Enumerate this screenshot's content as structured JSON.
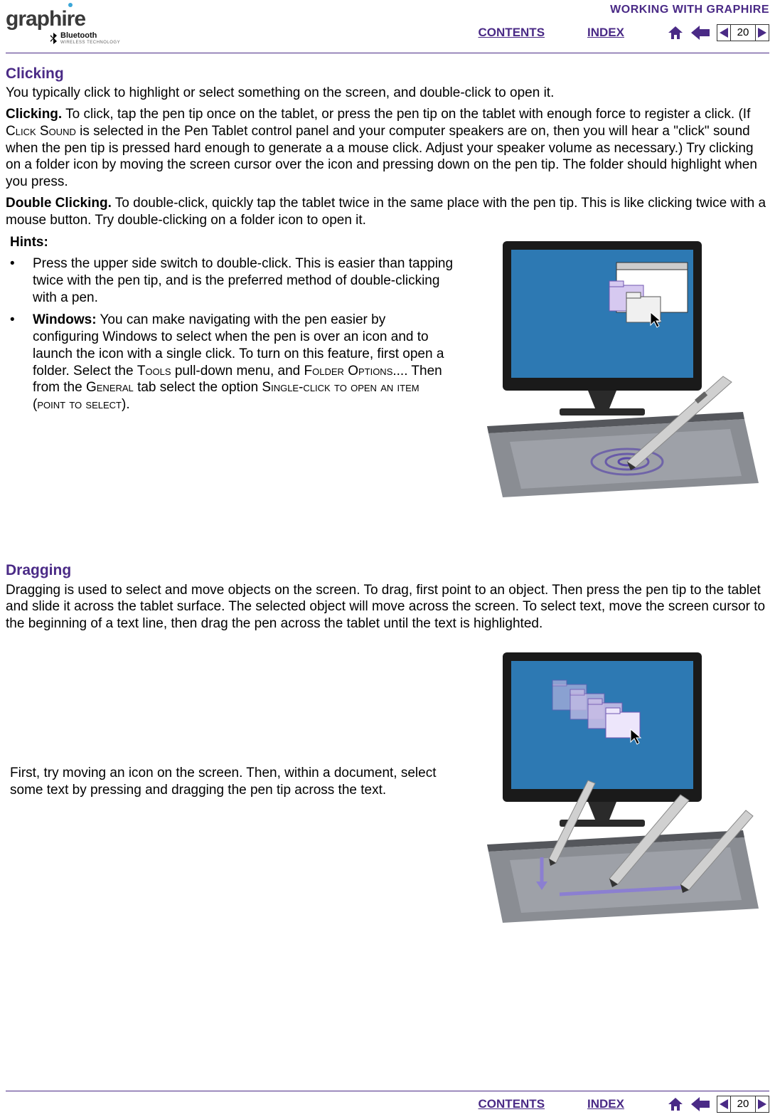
{
  "header": {
    "logo": "graphire",
    "bt": "Bluetooth",
    "bt_sub": "WIRELESS TECHNOLOGY",
    "section": "WORKING WITH GRAPHIRE",
    "contents": "CONTENTS",
    "index": "INDEX",
    "page": "20"
  },
  "clicking": {
    "title": "Clicking",
    "intro": "You typically click to highlight or select something on the screen, and double-click to open it.",
    "p1a": "Clicking.",
    "p1b": " To click, tap the pen tip once on the tablet, or press the pen tip on the tablet with enough force to register a click. (If  ",
    "p1c": "Click Sound",
    "p1d": " is selected in the Pen Tablet control panel and your computer speakers are on, then you will hear a \"click\" sound when the pen tip is pressed hard enough to generate a a mouse click. Adjust your speaker volume as necessary.)  Try clicking on a folder icon by moving the screen cursor over the icon and pressing down on the pen tip.  The folder should highlight when you press.",
    "p2a": "Double Clicking.",
    "p2b": "  To double-click, quickly tap the tablet twice in the same place with the pen tip.  This is like clicking twice with a mouse button.  Try double-clicking on a folder icon to open it."
  },
  "hints": {
    "title": "Hints:",
    "h1": "Press the upper side switch to double-click.  This is easier than tapping twice with the pen tip, and is the preferred method of double-clicking with a pen.",
    "h2a": "Windows:",
    "h2b": " You can make navigating with the pen easier by configuring Windows to select when the pen is over an icon and to launch the icon with a single click.  To turn on this feature, first open a folder.  Select the ",
    "h2c": "Tools",
    "h2d": " pull-down menu, and ",
    "h2e": "Folder Options...",
    "h2f": ".  Then from the ",
    "h2g": "General",
    "h2h": " tab select the option ",
    "h2i": "Single-click to open an item (point to select)",
    "h2j": "."
  },
  "dragging": {
    "title": "Dragging",
    "p1": "Dragging is used to select and move objects on the screen.  To drag, first point to an object.  Then press the pen tip to the tablet and slide it across the tablet surface.  The selected object will move across the screen.  To select text, move the screen cursor to the beginning of a text line, then drag the pen across the tablet until the text is highlighted.",
    "side": "First, try moving an icon on the screen.  Then, within a document, select some text by pressing and dragging the pen tip across the text."
  },
  "footer": {
    "contents": "CONTENTS",
    "index": "INDEX",
    "page": "20"
  }
}
